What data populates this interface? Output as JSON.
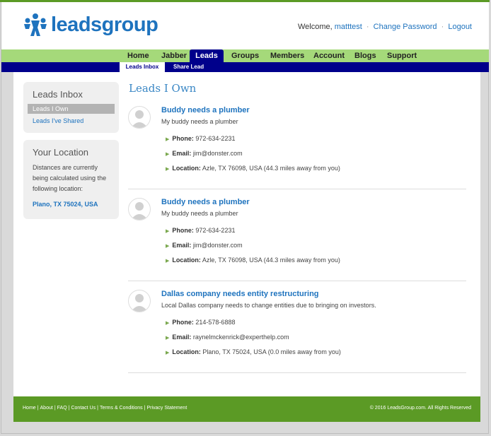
{
  "header": {
    "logo_text": "leadsgroup",
    "welcome": "Welcome,",
    "username": "matttest",
    "change_password": "Change Password",
    "logout": "Logout",
    "separator": "·"
  },
  "nav": {
    "items": [
      {
        "label": "Home"
      },
      {
        "label": "Jabber"
      },
      {
        "label": "Leads"
      },
      {
        "label": "Groups"
      },
      {
        "label": "Members"
      },
      {
        "label": "Account"
      },
      {
        "label": "Blogs"
      },
      {
        "label": "Support"
      }
    ],
    "active": "Leads"
  },
  "subnav": {
    "items": [
      {
        "label": "Leads Inbox"
      },
      {
        "label": "Share Lead"
      }
    ]
  },
  "sidebar": {
    "inbox_title": "Leads Inbox",
    "inbox_items": [
      {
        "label": "Leads I Own"
      },
      {
        "label": "Leads I've Shared"
      }
    ],
    "location_title": "Your Location",
    "location_text": "Distances are currently being calculated using the following location:",
    "location_value": "Plano, TX 75024, USA"
  },
  "main": {
    "title": "Leads I Own",
    "labels": {
      "phone": "Phone:",
      "email": "Email:",
      "location": "Location:"
    },
    "leads": [
      {
        "title": "Buddy needs a plumber",
        "description": "My buddy needs a plumber",
        "phone": "972-634-2231",
        "email": "jim@donster.com",
        "location": "Azle, TX 76098, USA (44.3 miles away from you)"
      },
      {
        "title": "Buddy needs a plumber",
        "description": "My buddy needs a plumber",
        "phone": "972-634-2231",
        "email": "jim@donster.com",
        "location": "Azle, TX 76098, USA (44.3 miles away from you)"
      },
      {
        "title": "Dallas company needs entity restructuring",
        "description": "Local Dallas company needs to change entities due to bringing on investors.",
        "phone": "214-578-6888",
        "email": "raynelmckenrick@experthelp.com",
        "location": "Plano, TX 75024, USA (0.0 miles away from you)"
      }
    ]
  },
  "footer": {
    "links": [
      {
        "label": "Home"
      },
      {
        "label": "About"
      },
      {
        "label": "FAQ"
      },
      {
        "label": "Contact Us"
      },
      {
        "label": "Terms & Conditions"
      },
      {
        "label": "Privacy Statement"
      }
    ],
    "link_separator": "|",
    "copyright": "© 2016 LeadsGroup.com. All Rights Reserved"
  },
  "colors": {
    "brand_blue": "#1e73be",
    "nav_green": "#a5d97a",
    "nav_navy": "#00008b",
    "footer_green": "#5b9a25"
  }
}
